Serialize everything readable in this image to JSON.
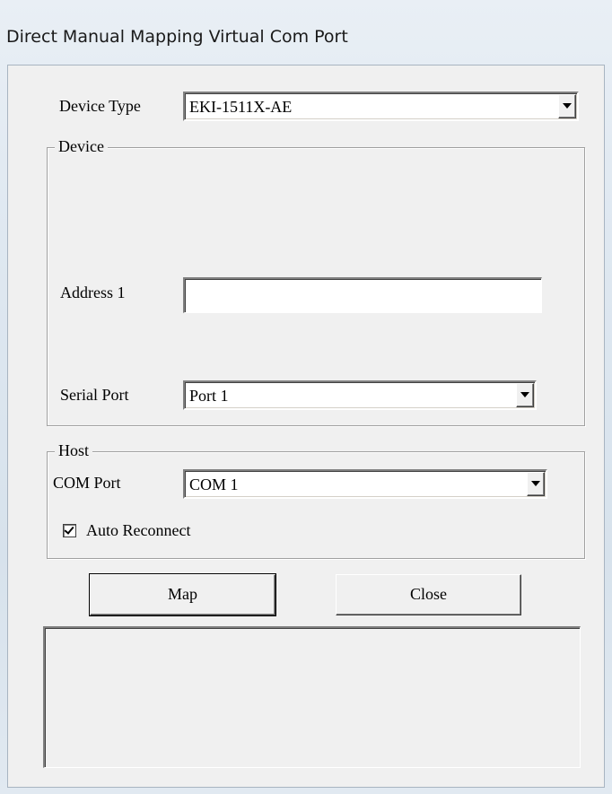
{
  "window": {
    "title": "Direct Manual Mapping Virtual Com Port"
  },
  "device_type": {
    "label": "Device Type",
    "value": "EKI-1511X-AE"
  },
  "device_group": {
    "title": "Device",
    "address_label": "Address 1",
    "address_value": "",
    "serial_port_label": "Serial Port",
    "serial_port_value": "Port 1"
  },
  "host_group": {
    "title": "Host",
    "com_port_label": "COM Port",
    "com_port_value": "COM 1",
    "auto_reconnect_label": "Auto Reconnect",
    "auto_reconnect_checked": true
  },
  "buttons": {
    "map_label": "Map",
    "close_label": "Close"
  },
  "icons": {
    "dropdown": "chevron-down-icon",
    "checkbox": "checkmark-icon"
  }
}
